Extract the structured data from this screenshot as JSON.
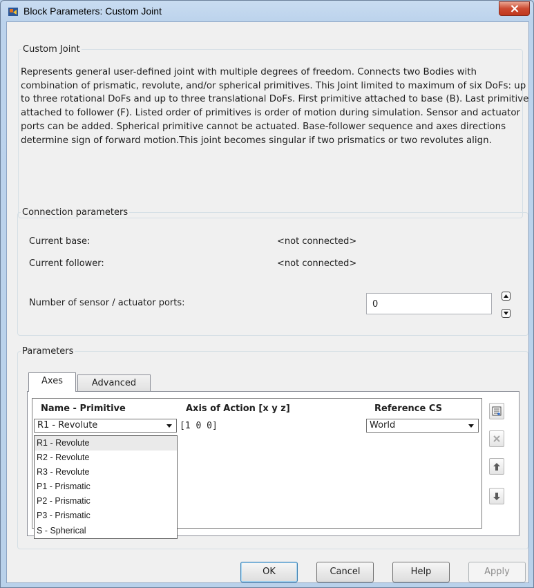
{
  "window": {
    "title": "Block Parameters: Custom Joint",
    "close_glyph": "✕"
  },
  "description_group": {
    "legend": "Custom Joint",
    "text": "Represents general user-defined joint with multiple degrees of freedom. Connects two Bodies with combination of prismatic, revolute, and/or spherical primitives. This Joint limited to maximum of six DoFs: up to three rotational DoFs and up to three translational DoFs. First primitive attached to base (B). Last primitive attached to follower (F). Listed order of primitives is order of motion during simulation. Sensor and actuator ports can be added. Spherical primitive cannot be actuated. Base-follower sequence and axes directions determine sign of forward motion.This joint becomes singular if two prismatics or two revolutes align."
  },
  "connection": {
    "legend": "Connection parameters",
    "current_base_label": "Current base:",
    "current_base_value": "<not connected>",
    "current_follower_label": "Current follower:",
    "current_follower_value": "<not connected>",
    "ports_label": "Number of sensor / actuator ports:",
    "ports_value": "0"
  },
  "parameters": {
    "legend": "Parameters",
    "tabs": [
      {
        "label": "Axes",
        "active": true
      },
      {
        "label": "Advanced",
        "active": false
      }
    ],
    "columns": [
      "Name - Primitive",
      "Axis of Action [x y z]",
      "Reference CS"
    ],
    "row": {
      "primitive": "R1 - Revolute",
      "axis": "[1 0 0]",
      "reference": "World"
    },
    "dropdown_options": [
      "R1 - Revolute",
      "R2 - Revolute",
      "R3 - Revolute",
      "P1 - Prismatic",
      "P2 - Prismatic",
      "P3 - Prismatic",
      "S - Spherical"
    ],
    "side_buttons": [
      "add-row-icon",
      "delete-row-icon",
      "move-up-icon",
      "move-down-icon"
    ]
  },
  "buttons": {
    "ok": "OK",
    "cancel": "Cancel",
    "help": "Help",
    "apply": "Apply"
  },
  "colors": {
    "frame": "#b9d1ea",
    "client": "#f0f0f0",
    "close_red": "#c9432b"
  }
}
